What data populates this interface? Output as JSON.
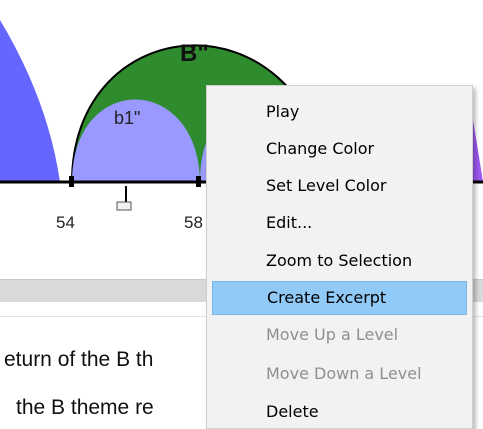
{
  "arc_diagram": {
    "large_arc_label": "B\"",
    "small_arc_label": "b1\"",
    "tick_labels": [
      "54",
      "58"
    ],
    "colors": {
      "large_arc": "#2e8b2e",
      "small_arc": "#9999ff",
      "left_partial_arc": "#6666ff",
      "right_partial_arc": "#9f58f0",
      "baseline": "#000000"
    }
  },
  "text_panel": {
    "line_1": "eturn of the B th",
    "line_2": "the B theme re"
  },
  "context_menu": {
    "items": [
      {
        "label": "Play",
        "enabled": true,
        "highlighted": false
      },
      {
        "label": "Change Color",
        "enabled": true,
        "highlighted": false
      },
      {
        "label": "Set Level Color",
        "enabled": true,
        "highlighted": false
      },
      {
        "label": "Edit...",
        "enabled": true,
        "highlighted": false
      },
      {
        "label": "Zoom to Selection",
        "enabled": true,
        "highlighted": false
      },
      {
        "label": "Create Excerpt",
        "enabled": true,
        "highlighted": true
      },
      {
        "label": "Move Up a Level",
        "enabled": false,
        "highlighted": false
      },
      {
        "label": "Move Down a Level",
        "enabled": false,
        "highlighted": false
      },
      {
        "label": "Delete",
        "enabled": true,
        "highlighted": false
      }
    ],
    "colors": {
      "background": "#f2f2f2",
      "highlight": "#91c9f7",
      "disabled_text": "#8f8f8f"
    }
  }
}
